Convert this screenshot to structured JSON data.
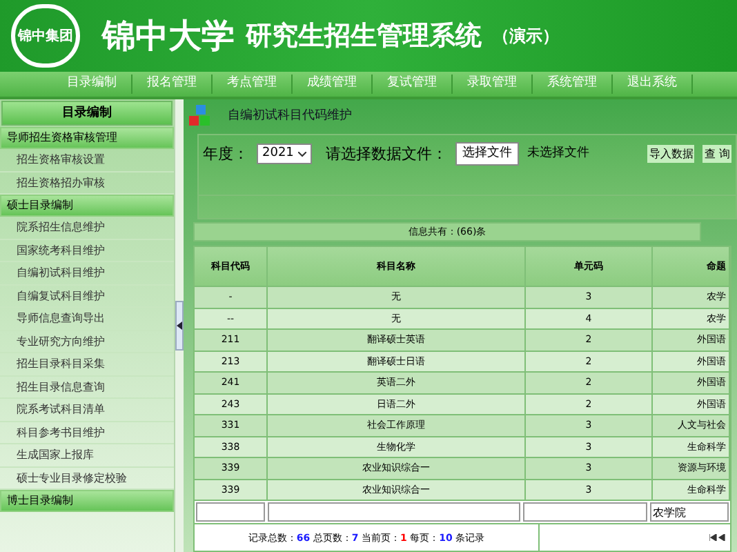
{
  "header": {
    "logo_text": "锦中集团",
    "title": "锦中大学",
    "subtitle": "研究生招生管理系统",
    "note": "（演示）"
  },
  "nav": [
    "目录编制",
    "报名管理",
    "考点管理",
    "成绩管理",
    "复试管理",
    "录取管理",
    "系统管理",
    "退出系统"
  ],
  "sidebar": {
    "title": "目录编制",
    "groups": [
      {
        "label": "导师招生资格审核管理",
        "items": [
          "招生资格审核设置",
          "招生资格招办审核"
        ]
      },
      {
        "label": "硕士目录编制",
        "items": [
          "院系招生信息维护",
          "国家统考科目维护",
          "自编初试科目维护",
          "自编复试科目维护",
          "导师信息查询导出",
          "专业研究方向维护",
          "招生目录科目采集",
          "招生目录信息查询",
          "院系考试科目清单",
          "科目参考书目维护",
          "生成国家上报库",
          "硕士专业目录修定校验"
        ]
      },
      {
        "label": "博士目录编制"
      }
    ]
  },
  "page_title": "自编初试科目代码维护",
  "toolbar": {
    "year_label": "年度：",
    "year": "2021",
    "file_label": "请选择数据文件：",
    "file_button": "选择文件",
    "file_status": "未选择文件",
    "import_button": "导入数据",
    "query_button": "查 询"
  },
  "info": "信息共有：(66)条",
  "table": {
    "columns": [
      "科目代码",
      "科目名称",
      "单元码",
      "命题"
    ],
    "rows": [
      [
        "-",
        "无",
        "3",
        "农学"
      ],
      [
        "--",
        "无",
        "4",
        "农学"
      ],
      [
        "211",
        "翻译硕士英语",
        "2",
        "外国语"
      ],
      [
        "213",
        "翻译硕士日语",
        "2",
        "外国语"
      ],
      [
        "241",
        "英语二外",
        "2",
        "外国语"
      ],
      [
        "243",
        "日语二外",
        "2",
        "外国语"
      ],
      [
        "331",
        "社会工作原理",
        "3",
        "人文与社会"
      ],
      [
        "338",
        "生物化学",
        "3",
        "生命科学"
      ],
      [
        "339",
        "农业知识综合一",
        "3",
        "资源与环境"
      ],
      [
        "339",
        "农业知识综合一",
        "3",
        "生命科学"
      ]
    ],
    "filter_value": "农学院"
  },
  "pager": [
    {
      "label": "记录总数：",
      "value": "66",
      "color": "#1a1aff"
    },
    {
      "label": "总页数：",
      "value": "7",
      "color": "#1a1aff"
    },
    {
      "label": "当前页：",
      "value": "1",
      "color": "#ff0000"
    },
    {
      "label": "每页：",
      "value": "10",
      "color": "#1a1aff"
    }
  ],
  "pager_suffix": "条记录"
}
